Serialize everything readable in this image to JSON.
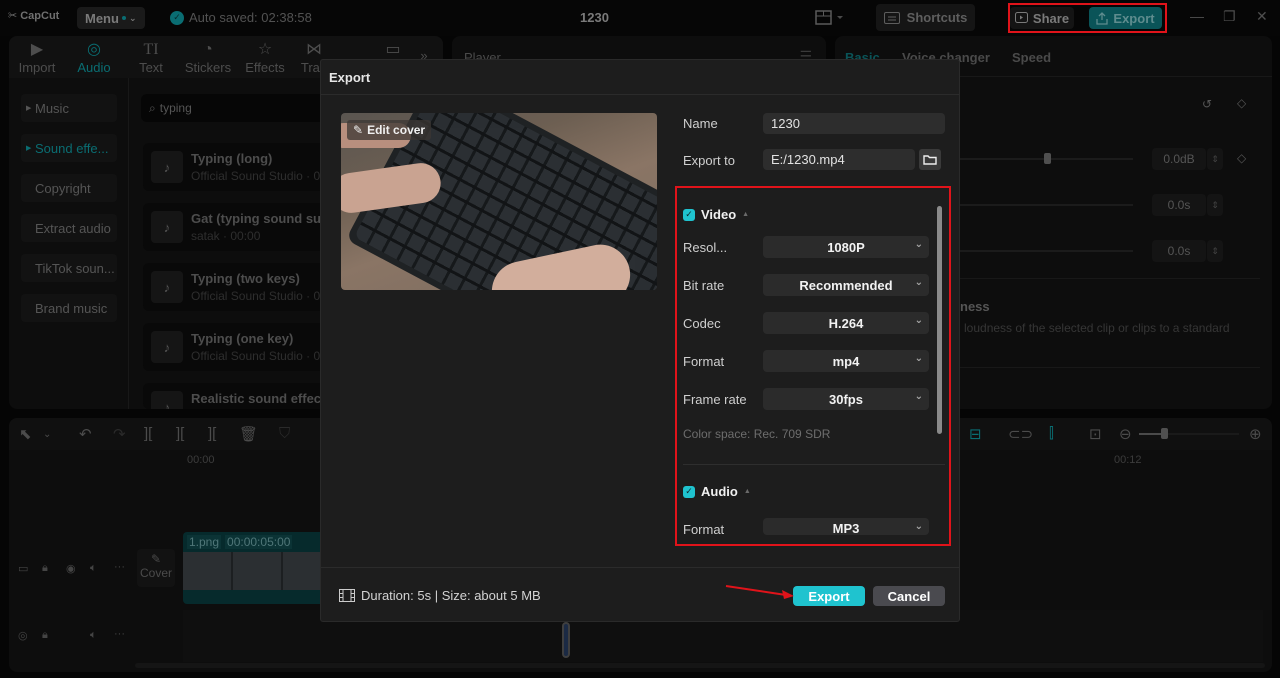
{
  "app": {
    "logo": "CapCut",
    "menu_label": "Menu",
    "autosave": "Auto saved: 02:38:58",
    "project_title": "1230",
    "shortcuts_label": "Shortcuts",
    "share_label": "Share",
    "export_label": "Export"
  },
  "media": {
    "tabs": [
      {
        "label": "Import",
        "icon": "import-icon"
      },
      {
        "label": "Audio",
        "icon": "audio-icon",
        "active": true
      },
      {
        "label": "Text",
        "icon": "text-icon"
      },
      {
        "label": "Stickers",
        "icon": "stickers-icon"
      },
      {
        "label": "Effects",
        "icon": "effects-icon"
      },
      {
        "label": "Tran",
        "icon": "transitions-icon"
      },
      {
        "label": "",
        "icon": "captions-icon"
      }
    ],
    "categories": [
      "Music",
      "Sound effe...",
      "Copyright",
      "Extract audio",
      "TikTok soun...",
      "Brand music"
    ],
    "search_value": "typing",
    "results": [
      {
        "title": "Typing (long)",
        "sub": "Official Sound Studio · 00"
      },
      {
        "title": "Gat (typing sound suc",
        "sub": "satak · 00:00"
      },
      {
        "title": "Typing (two keys)",
        "sub": "Official Sound Studio · 00"
      },
      {
        "title": "Typing (one key)",
        "sub": "Official Sound Studio · 00"
      },
      {
        "title": "Realistic sound effect",
        "sub": ""
      }
    ]
  },
  "player": {
    "label": "Player"
  },
  "props": {
    "tabs": [
      "Basic",
      "Voice changer",
      "Speed"
    ],
    "volume": "0.0dB",
    "fade_in": "0.0s",
    "fade_out": "0.0s",
    "volume_level": 0.5,
    "loudness_title": "ness",
    "loudness_desc": "l loudness of the selected clip or clips to a standard"
  },
  "timeline": {
    "ruler_start": "00:00",
    "ruler_mark": "00:12",
    "cover_label": "Cover",
    "clip_name": "1.png",
    "clip_duration": "00:00:05:00",
    "zoom_level": 0.25
  },
  "dialog": {
    "title": "Export",
    "edit_cover": "Edit cover",
    "name_label": "Name",
    "name_value": "1230",
    "export_to_label": "Export to",
    "export_to_value": "E:/1230.mp4",
    "video": {
      "label": "Video",
      "checked": true,
      "fields": [
        {
          "label": "Resol...",
          "value": "1080P"
        },
        {
          "label": "Bit rate",
          "value": "Recommended"
        },
        {
          "label": "Codec",
          "value": "H.264"
        },
        {
          "label": "Format",
          "value": "mp4"
        },
        {
          "label": "Frame rate",
          "value": "30fps"
        }
      ],
      "color_space": "Color space: Rec. 709 SDR"
    },
    "audio": {
      "label": "Audio",
      "checked": true,
      "fields": [
        {
          "label": "Format",
          "value": "MP3"
        }
      ]
    },
    "footer_info": "Duration: 5s | Size: about 5 MB",
    "export_button": "Export",
    "cancel_button": "Cancel"
  },
  "colors": {
    "accent": "#1fc3cf",
    "highlight": "#e0131a",
    "dialog_bg": "#1d1d1d"
  }
}
